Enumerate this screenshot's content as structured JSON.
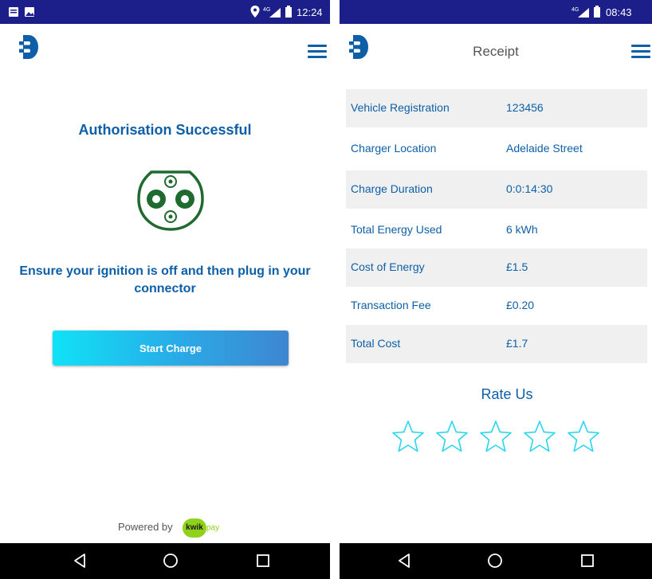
{
  "left": {
    "status_time": "12:24",
    "auth_title": "Authorisation Successful",
    "instruction": "Ensure your ignition is off and then plug in your connector",
    "start_button": "Start Charge",
    "powered_by": "Powered by",
    "kwik_brand": "kwik",
    "pay_brand": "pay"
  },
  "right": {
    "status_time": "08:43",
    "title": "Receipt",
    "rows": [
      {
        "label": "Vehicle Registration",
        "value": "123456"
      },
      {
        "label": "Charger Location",
        "value": "Adelaide Street"
      },
      {
        "label": "Charge Duration",
        "value": "0:0:14:30"
      },
      {
        "label": "Total Energy Used",
        "value": "6 kWh"
      },
      {
        "label": "Cost of Energy",
        "value": "£1.5"
      },
      {
        "label": "Transaction Fee",
        "value": "£0.20"
      },
      {
        "label": "Total Cost",
        "value": "£1.7"
      }
    ],
    "rate_title": "Rate Us",
    "rating": 0,
    "max_rating": 5
  },
  "colors": {
    "brand_blue": "#0d5fa8",
    "status_bar": "#1c1f8a",
    "connector_green": "#1e6a2f",
    "star_outline": "#27d6ee",
    "kwik_green": "#8fd11b"
  },
  "icons": [
    "logo-icon",
    "menu-icon",
    "connector-icon",
    "star-icon",
    "back-icon",
    "home-icon",
    "recents-icon",
    "location-icon",
    "signal-icon",
    "battery-icon"
  ]
}
